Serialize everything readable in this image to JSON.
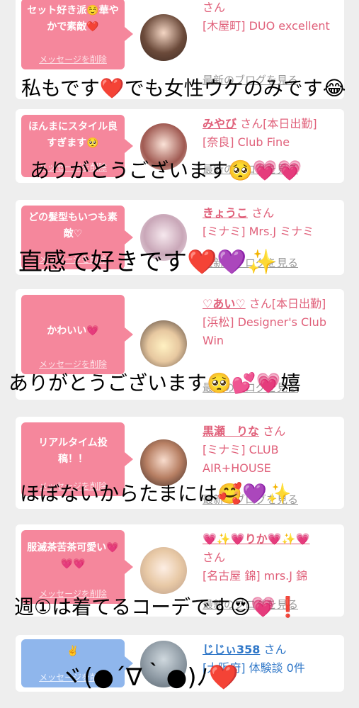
{
  "posts": [
    {
      "message": "セット好き派☺️華やかで素敵❤️",
      "delete": "メッセージを削除",
      "name": "",
      "san": "さん",
      "shop": "[木屋町] DUO excellent",
      "blog": "最新のブログを見る",
      "overlay": "私もです❤️でも女性ウケのみです😂"
    },
    {
      "message": "ほんまにスタイル良すぎます🥺",
      "delete": "メッセージを削除",
      "name": "みやび",
      "san": "さん[本日出勤]",
      "shop": "[奈良] Club Fine",
      "blog": "最新のブログを見る",
      "overlay": "ありがとうございます🥺💗💗"
    },
    {
      "message": "どの髪型もいつも素敵♡",
      "delete": "メッセージを削除",
      "name": "きょうこ",
      "san": "さん",
      "shop": "[ミナミ] Mrs.J ミナミ",
      "blog": "最新のブログを見る",
      "overlay": "直感で好きです❤️💜✨"
    },
    {
      "message": "かわいい💗",
      "delete": "メッセージを削除",
      "name": "♡あい♡",
      "san": "さん[本日出勤]",
      "shop": "[浜松] Designer's Club Win",
      "blog": "最新のブログを見る",
      "overlay": "ありがとうございます🥺💕💗嬉"
    },
    {
      "message": "リアルタイム投稿！！",
      "delete": "メッセージを削除",
      "name": "黒瀬　りな",
      "san": "さん",
      "shop": "[ミナミ] CLUB AIR+HOUSE",
      "blog": "最新のブログを見る",
      "overlay": "ほぼないからたまには🥰💜✨"
    },
    {
      "message": "服滅茶苦茶可愛い💗💗💗",
      "delete": "メッセージを削除",
      "name": "💗✨💗りか💗✨💗",
      "san": "さん",
      "shop": "[名古屋 錦] mrs.J 錦",
      "blog": "最新のブログを見る",
      "overlay": "週①は着てるコーデです😍💗❗️"
    },
    {
      "message": "✌️",
      "delete": "メッセージを削除",
      "name": "じじぃ358",
      "san": "さん",
      "shop": "[大阪府] 体験談 0件",
      "blog": "",
      "overlay": "ヾ(●´∇｀●)ﾉ❤️"
    }
  ]
}
